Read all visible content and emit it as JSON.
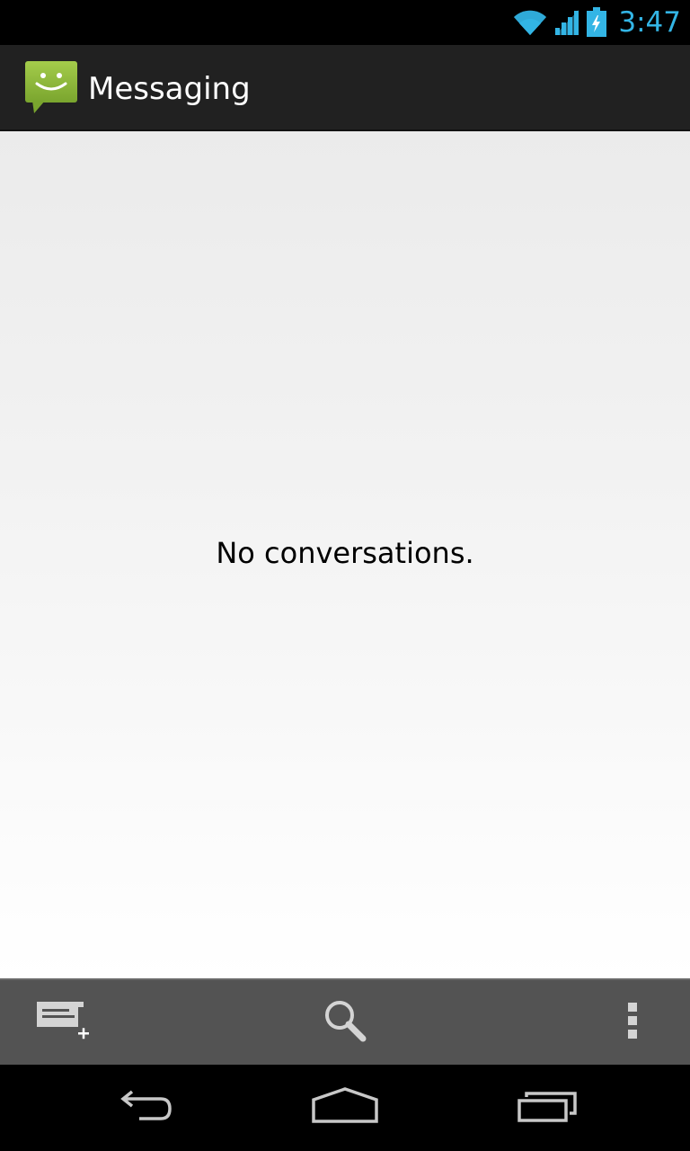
{
  "status_bar": {
    "time": "3:47",
    "icons": [
      "wifi-icon",
      "signal-icon",
      "battery-charging-icon"
    ],
    "accent_color": "#33b5e5"
  },
  "action_bar": {
    "title": "Messaging",
    "app_icon": "messaging-app-icon",
    "icon_color": "#8ab43c"
  },
  "content": {
    "empty_message": "No conversations."
  },
  "bottom_bar": {
    "actions": [
      "compose-new-message-icon",
      "search-icon",
      "overflow-menu-icon"
    ]
  },
  "nav_bar": {
    "buttons": [
      "back-icon",
      "home-icon",
      "recent-apps-icon"
    ]
  }
}
